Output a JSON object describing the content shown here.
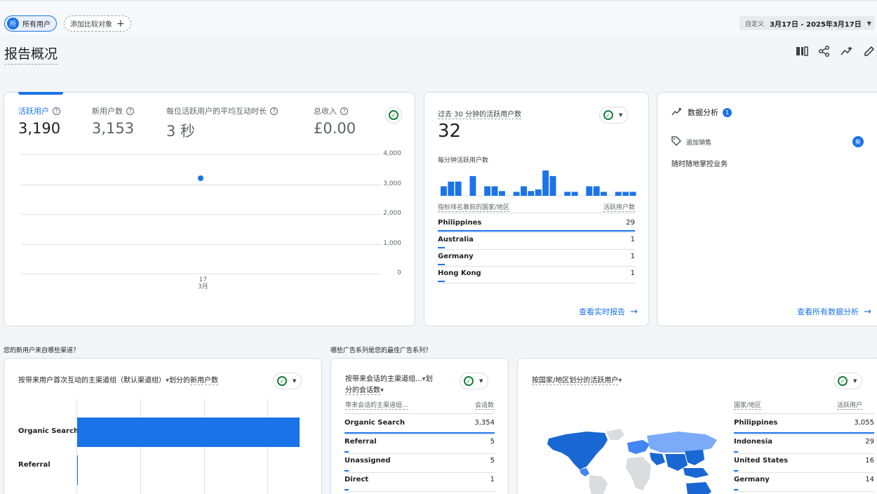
{
  "topbar": {
    "all_users_avatar": "所",
    "all_users_label": "所有用户",
    "add_compare_label": "添加比较对象",
    "date_prefix": "自定义",
    "date_value": "3月17日 - 2025年3月17日"
  },
  "page": {
    "title": "报告概况"
  },
  "toolbar": {
    "icons": [
      "columns-icon",
      "share-icon",
      "insights-icon",
      "edit-icon"
    ]
  },
  "overview": {
    "metrics": [
      {
        "label": "活跃用户",
        "value": "3,190"
      },
      {
        "label": "新用户数",
        "value": "3,153"
      },
      {
        "label": "每位活跃用户的平均互动时长",
        "value": "3 秒"
      },
      {
        "label": "总收入",
        "value": "£0.00"
      }
    ],
    "y_ticks": [
      "4,000",
      "3,000",
      "2,000",
      "1,000",
      "0"
    ],
    "x_day": "17",
    "x_month": "3月"
  },
  "chart_data": [
    {
      "type": "scatter",
      "x": [
        "3月17日"
      ],
      "series": [
        {
          "name": "活跃用户",
          "values": [
            3190
          ]
        }
      ],
      "ylim": [
        0,
        4000
      ],
      "grid": true
    },
    {
      "type": "bar",
      "values": [
        12,
        18,
        18,
        0,
        25,
        0,
        12,
        12,
        6,
        0,
        5,
        12,
        6,
        8,
        32,
        25,
        0,
        5,
        5,
        0,
        12,
        12,
        5,
        0,
        5,
        5,
        5
      ],
      "title": "每分钟活跃用户数"
    },
    {
      "type": "bar",
      "categories": [
        "Organic Search",
        "Referral"
      ],
      "values": [
        3150,
        5
      ]
    }
  ],
  "realtime": {
    "title": "过去 30 分钟的活跃用户数",
    "value": "32",
    "per_minute_label": "每分钟活跃用户数",
    "col_country": "指标排名靠前的国家/地区",
    "col_users": "活跃用户数",
    "rows": [
      {
        "name": "Philippines",
        "value": "29",
        "share": 1.0
      },
      {
        "name": "Australia",
        "value": "1",
        "share": 0.035
      },
      {
        "name": "Germany",
        "value": "1",
        "share": 0.035
      },
      {
        "name": "Hong Kong",
        "value": "1",
        "share": 0.035
      }
    ],
    "link": "查看实时报告"
  },
  "insights": {
    "title": "数据分析",
    "badge": "1",
    "item_label": "追加销售",
    "new_badge": "新",
    "item_desc": "随时随地掌控业务",
    "link": "查看所有数据分析"
  },
  "questions": {
    "q1": "您的新用户来自哪些渠道？",
    "q2": "哪些广告系列是您的最佳广告系列？"
  },
  "channel_card": {
    "title_pre": "按带来用户首次互动的主渠道组（默认渠道组）",
    "title_caret": "▾",
    "title_mid": "划分的",
    "title_metric": "新用户数",
    "categories": [
      "Organic Search",
      "Referral"
    ]
  },
  "session_card": {
    "title_line1": "按带来会话的主渠道组...",
    "title_caret": "▾",
    "title_line1_tail": "划",
    "title_line2": "分的会话数",
    "col_channel": "带来会话的主渠道组...",
    "col_sessions": "会话数",
    "rows": [
      {
        "name": "Organic Search",
        "value": "3,354",
        "share": 1.0
      },
      {
        "name": "Referral",
        "value": "5",
        "share": 0.012
      },
      {
        "name": "Unassigned",
        "value": "5",
        "share": 0.012
      },
      {
        "name": "Direct",
        "value": "1",
        "share": 0.005
      }
    ]
  },
  "country_card": {
    "title": "按国家/地区划分的活跃用户",
    "title_caret": "▾",
    "col_country": "国家/地区",
    "col_users": "活跃用户",
    "rows": [
      {
        "name": "Philippines",
        "value": "3,055",
        "share": 1.0
      },
      {
        "name": "Indonesia",
        "value": "29",
        "share": 0.01
      },
      {
        "name": "United States",
        "value": "16",
        "share": 0.006
      },
      {
        "name": "Germany",
        "value": "14",
        "share": 0.005
      }
    ]
  },
  "colors": {
    "accent": "#1a73e8",
    "check": "#188038",
    "map_light": "#7baaf7",
    "map_mid": "#4285f4",
    "map_dark": "#1967d2",
    "map_empty": "#dadce0"
  }
}
